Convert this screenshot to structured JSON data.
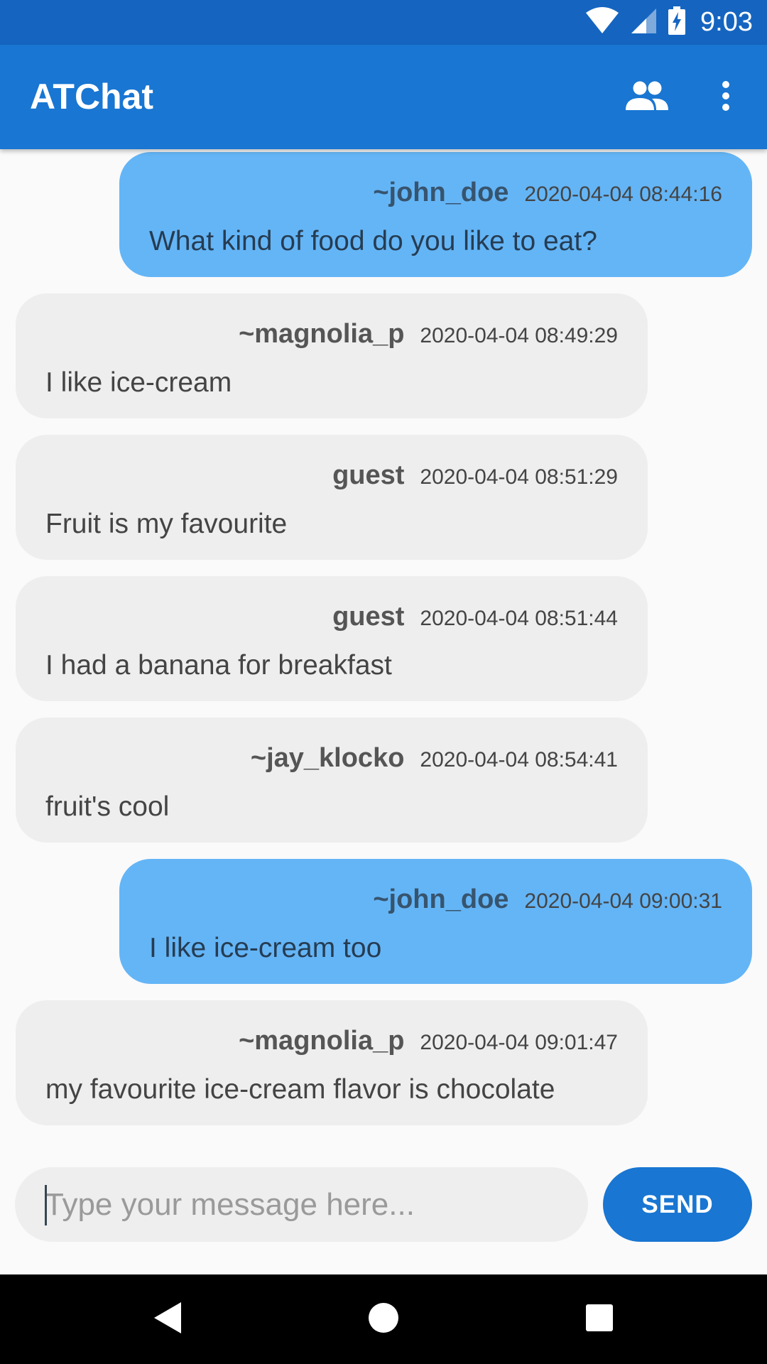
{
  "status_bar": {
    "time": "9:03",
    "icons": [
      "wifi-icon",
      "cell-signal-icon",
      "battery-charging-icon"
    ]
  },
  "app_bar": {
    "title": "ATChat",
    "actions": [
      "people-icon",
      "more-vert-icon"
    ],
    "color": "#1976d2"
  },
  "messages": [
    {
      "user": "~john_doe",
      "time": "2020-04-04 08:44:16",
      "text": "What kind of food do you like to eat?",
      "own": true
    },
    {
      "user": "~magnolia_p",
      "time": "2020-04-04 08:49:29",
      "text": "I like ice-cream",
      "own": false
    },
    {
      "user": "guest",
      "time": "2020-04-04 08:51:29",
      "text": "Fruit is my favourite",
      "own": false
    },
    {
      "user": "guest",
      "time": "2020-04-04 08:51:44",
      "text": "I had a banana for breakfast",
      "own": false
    },
    {
      "user": "~jay_klocko",
      "time": "2020-04-04 08:54:41",
      "text": "fruit's cool",
      "own": false
    },
    {
      "user": "~john_doe",
      "time": "2020-04-04 09:00:31",
      "text": "I like ice-cream too",
      "own": true
    },
    {
      "user": "~magnolia_p",
      "time": "2020-04-04 09:01:47",
      "text": "my favourite ice-cream flavor is chocolate",
      "own": false
    }
  ],
  "composer": {
    "placeholder": "Type your message here...",
    "value": "",
    "send_label": "SEND"
  },
  "nav_bar": {
    "buttons": [
      "back-icon",
      "home-icon",
      "recents-icon"
    ]
  },
  "colors": {
    "own_bubble": "#64b5f6",
    "other_bubble": "#eeeeee",
    "accent": "#1976d2",
    "status_bar": "#1565c0"
  }
}
